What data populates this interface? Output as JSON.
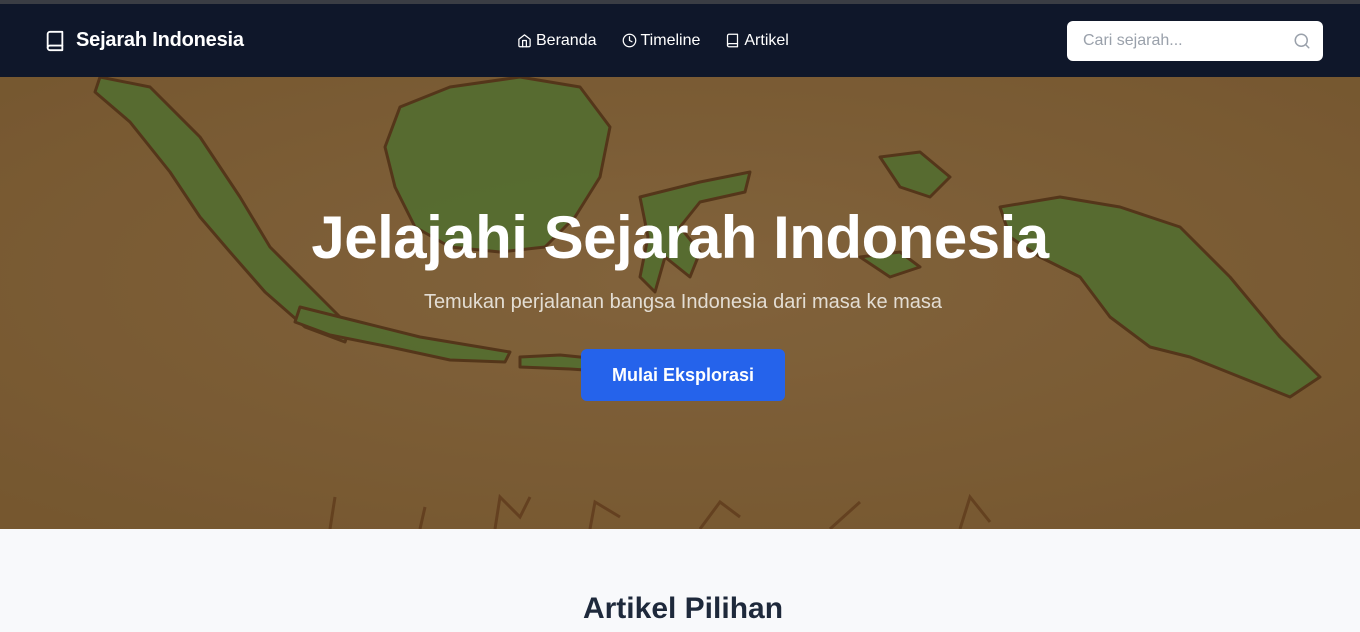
{
  "brand": {
    "name": "Sejarah Indonesia",
    "icon": "book-icon"
  },
  "nav": {
    "items": [
      {
        "label": "Beranda",
        "icon": "home-icon"
      },
      {
        "label": "Timeline",
        "icon": "clock-icon"
      },
      {
        "label": "Artikel",
        "icon": "book-icon"
      }
    ]
  },
  "search": {
    "placeholder": "Cari sejarah...",
    "value": "",
    "icon": "search-icon"
  },
  "hero": {
    "title": "Jelajahi Sejarah Indonesia",
    "subtitle": "Temukan perjalanan bangsa Indonesia dari masa ke masa",
    "button_label": "Mulai Eksplorasi"
  },
  "section": {
    "title": "Artikel Pilihan"
  },
  "colors": {
    "navbar": "#0f172a",
    "accent": "#2563eb",
    "hero_bg": "#86693f",
    "land": "#4e7a34"
  }
}
